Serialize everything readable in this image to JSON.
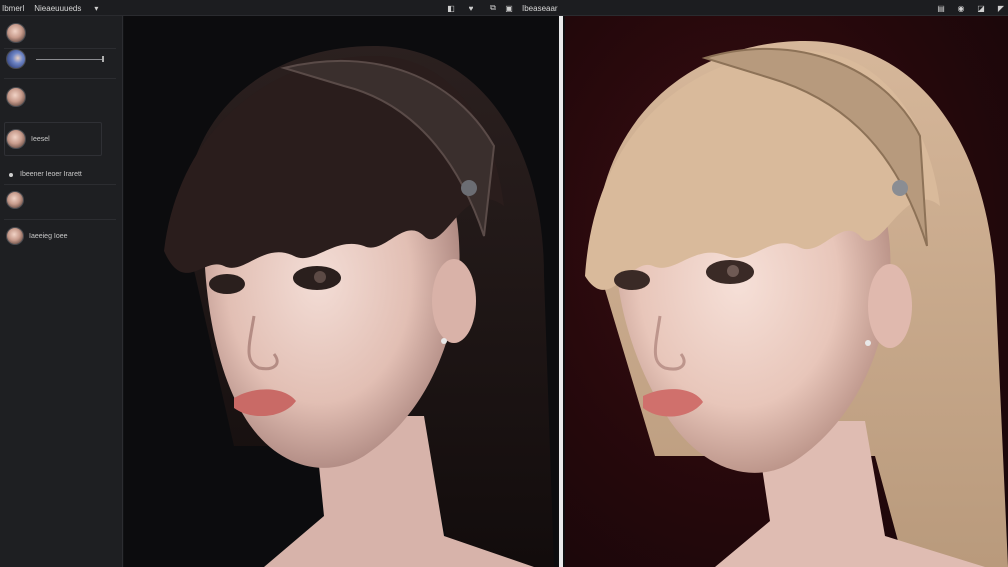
{
  "topbar": {
    "menu": [
      "Ibmerl",
      "Nieaeuuueds"
    ],
    "mid_icons": [
      "layers-icon",
      "heart-icon"
    ],
    "right_menu": [
      "Ibeaseaar"
    ],
    "right_icons": [
      "copy-icon",
      "image-icon"
    ],
    "far_right_icons": [
      "stack-icon",
      "globe-icon",
      "eraser-icon",
      "cursor-icon"
    ]
  },
  "sidebar": {
    "layers": [
      {
        "label": ""
      },
      {
        "label": ""
      },
      {
        "label": ""
      },
      {
        "label": "Ieesel"
      },
      {
        "label": "Ibeener Ieoer Irarett"
      },
      {
        "label": ""
      },
      {
        "label": "Iaeeieg Ioee"
      }
    ]
  },
  "colors": {
    "sidebar_bg": "#1e1f22",
    "left_canvas_bg": "#0c0c0e",
    "right_canvas_bg": "#2a0a0e",
    "split_line": "#e9e9ea"
  }
}
